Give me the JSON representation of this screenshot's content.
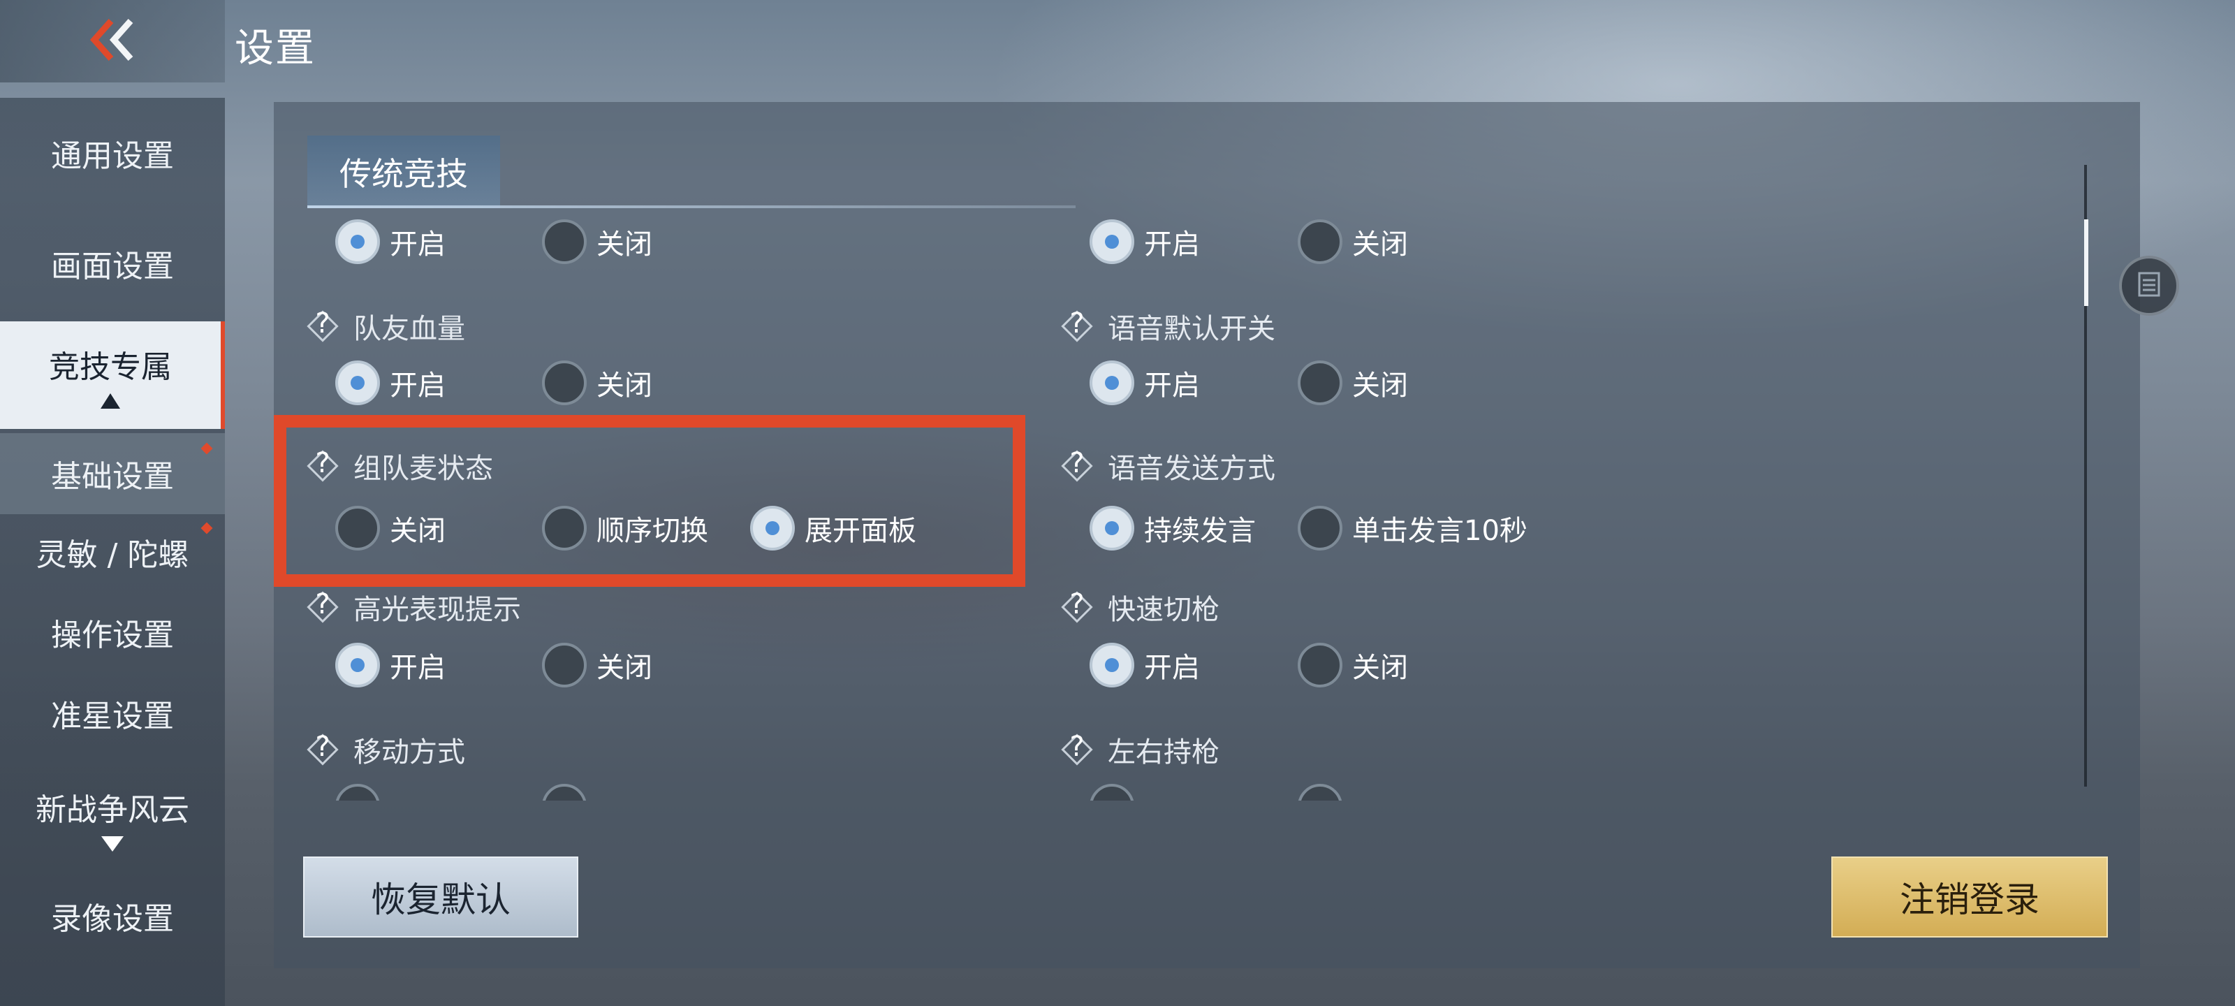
{
  "header": {
    "back_icon": "double-chevron-left-icon",
    "title": "设置"
  },
  "sidebar": {
    "items": [
      {
        "label": "通用设置",
        "active": false
      },
      {
        "label": "画面设置",
        "active": false
      },
      {
        "label": "竞技专属",
        "active": true
      },
      {
        "label": "基础设置",
        "active": false,
        "new_badge": true
      },
      {
        "label": "灵敏 / 陀螺",
        "active": false,
        "new_badge": true
      },
      {
        "label": "操作设置",
        "active": false
      },
      {
        "label": "准星设置",
        "active": false
      },
      {
        "label": "新战争风云",
        "active": false
      },
      {
        "label": "录像设置",
        "active": false
      }
    ]
  },
  "tab": {
    "label": "传统竞技"
  },
  "left_column": {
    "row0": {
      "opts": [
        "开启",
        "关闭"
      ],
      "selected": 0
    },
    "teammate_hp": {
      "label": "队友血量",
      "opts": [
        "开启",
        "关闭"
      ],
      "selected": 0
    },
    "team_mic": {
      "label": "组队麦状态",
      "opts": [
        "关闭",
        "顺序切换",
        "展开面板"
      ],
      "selected": 2
    },
    "highlight_tip": {
      "label": "高光表现提示",
      "opts": [
        "开启",
        "关闭"
      ],
      "selected": 0
    },
    "move_mode": {
      "label": "移动方式"
    }
  },
  "right_column": {
    "row0": {
      "opts": [
        "开启",
        "关闭"
      ],
      "selected": 0
    },
    "voice_default": {
      "label": "语音默认开关",
      "opts": [
        "开启",
        "关闭"
      ],
      "selected": 0
    },
    "voice_send": {
      "label": "语音发送方式",
      "opts": [
        "持续发言",
        "单击发言10秒"
      ],
      "selected": 0
    },
    "quick_switch": {
      "label": "快速切枪",
      "opts": [
        "开启",
        "关闭"
      ],
      "selected": 0
    },
    "hold_gun": {
      "label": "左右持枪"
    }
  },
  "buttons": {
    "restore_default": "恢复默认",
    "logout": "注销登录"
  },
  "colors": {
    "accent_red": "#e0492a",
    "logout_gold": "#d3ad55",
    "radio_selected": "#4f8fd6"
  }
}
